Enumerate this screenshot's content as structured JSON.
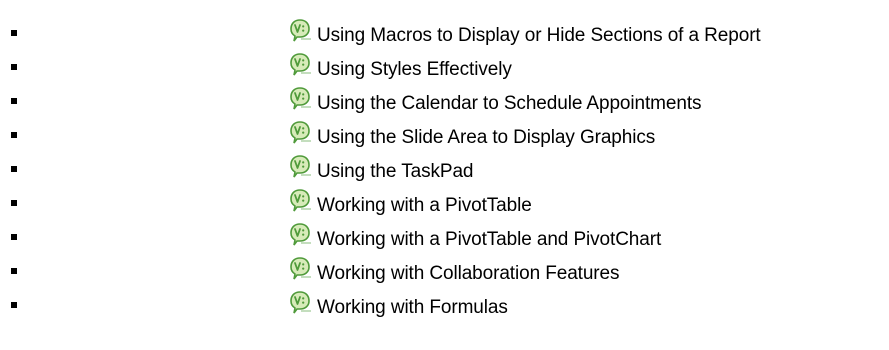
{
  "colors": {
    "icon_green": "#4f9a3a",
    "icon_light": "#d7ebb9",
    "text": "#000000"
  },
  "icon_name": "video-clip-icon",
  "items": [
    {
      "label": "Using Macros to Display or Hide Sections of a Report"
    },
    {
      "label": "Using Styles Effectively"
    },
    {
      "label": "Using the Calendar to Schedule Appointments"
    },
    {
      "label": "Using the Slide Area to Display Graphics"
    },
    {
      "label": "Using the TaskPad"
    },
    {
      "label": "Working with a PivotTable"
    },
    {
      "label": "Working with a PivotTable and PivotChart"
    },
    {
      "label": "Working with Collaboration Features"
    },
    {
      "label": "Working with Formulas"
    }
  ]
}
